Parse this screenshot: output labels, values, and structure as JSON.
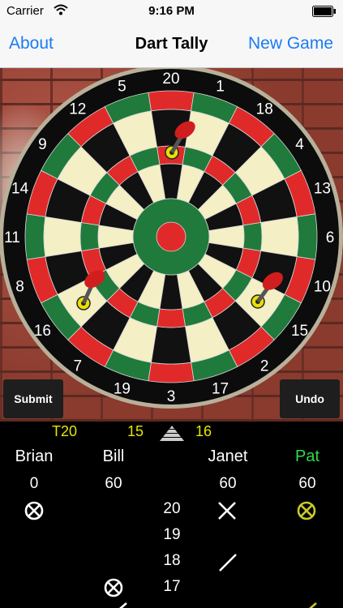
{
  "status_bar": {
    "carrier": "Carrier",
    "time": "9:16 PM"
  },
  "nav": {
    "about": "About",
    "title": "Dart Tally",
    "new_game": "New Game"
  },
  "board": {
    "numbers": [
      "20",
      "1",
      "18",
      "4",
      "13",
      "6",
      "10",
      "15",
      "2",
      "17",
      "3",
      "19",
      "7",
      "16",
      "8",
      "11",
      "14",
      "9",
      "12",
      "5"
    ],
    "colors": {
      "red": "#e02a2a",
      "green": "#1f7a3c",
      "black": "#111111",
      "cream": "#f4efc4"
    }
  },
  "buttons": {
    "submit": "Submit",
    "undo": "Undo"
  },
  "current_throws": [
    "T20",
    "15",
    "16"
  ],
  "players": [
    {
      "name": "Brian",
      "score": "0"
    },
    {
      "name": "Bill",
      "score": "60"
    },
    {
      "name": "Janet",
      "score": "60"
    },
    {
      "name": "Pat",
      "score": "60",
      "active": true
    }
  ],
  "targets": [
    "20",
    "19",
    "18",
    "17"
  ],
  "marks_legend": {
    "closed": "circle-x-icon",
    "two": "x-icon",
    "one": "slash-icon"
  }
}
